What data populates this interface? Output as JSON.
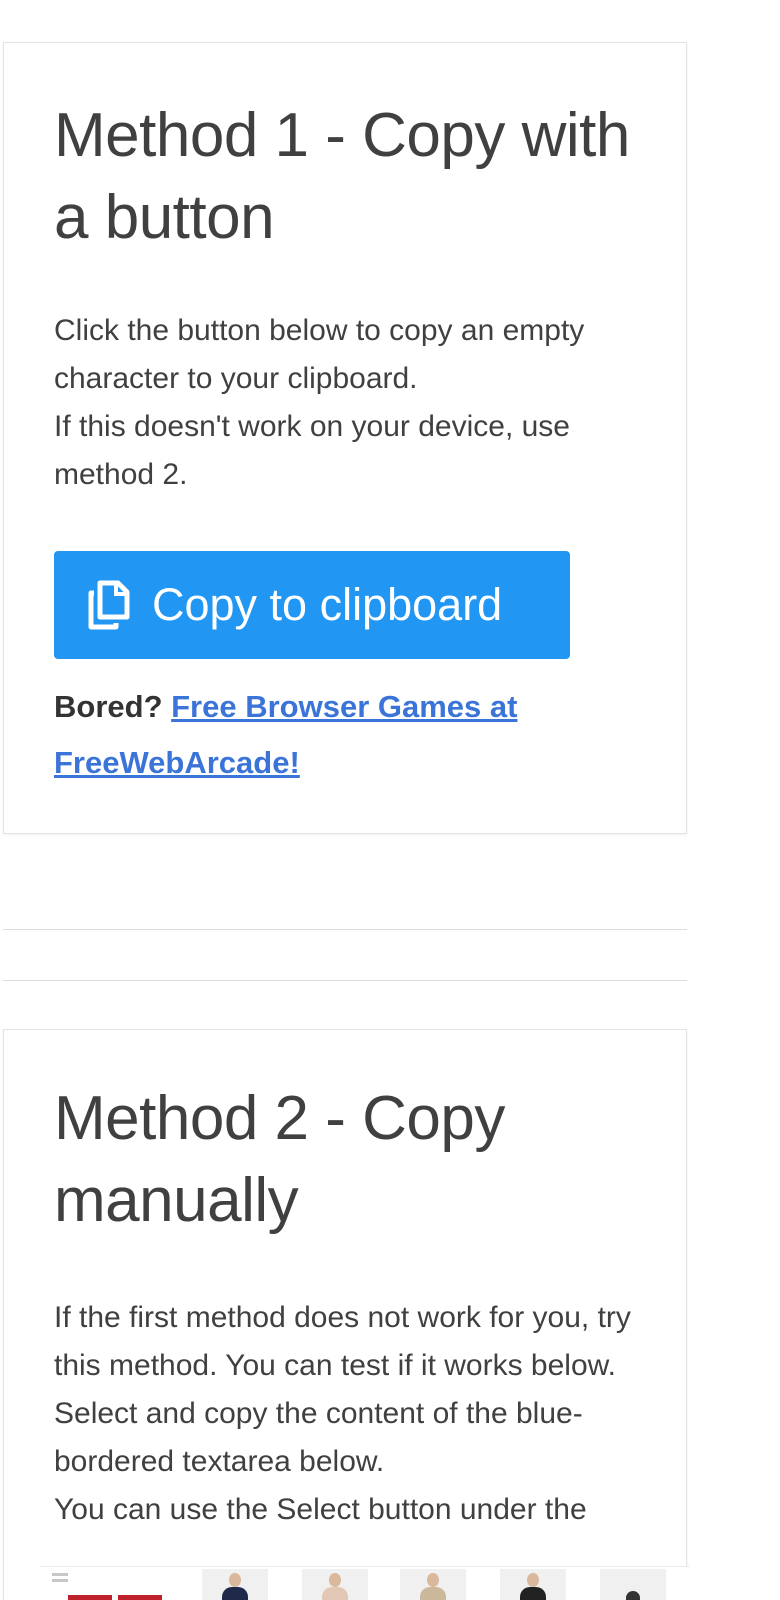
{
  "method1": {
    "title": "Method 1 - Copy with a button",
    "desc_line1": "Click the button below to copy an empty character to your clipboard.",
    "desc_line2": "If this doesn't work on your device, use method 2.",
    "copy_button_label": "Copy to clipboard",
    "bored_label": "Bored?",
    "bored_link": "Free Browser Games at FreeWebArcade!"
  },
  "method2": {
    "title": "Method 2 - Copy manually",
    "desc_line1": "If the first method does not work for you, try this method. You can test if it works below.",
    "desc_line2": "Select and copy the content of the blue-bordered textarea below.",
    "desc_line3": "You can use the Select button under the"
  },
  "colors": {
    "primary_button": "#2196f3",
    "link": "#3b74d8",
    "text": "#404040"
  },
  "icons": {
    "copy": "copy-icon",
    "ad_menu": "menu-icon"
  }
}
